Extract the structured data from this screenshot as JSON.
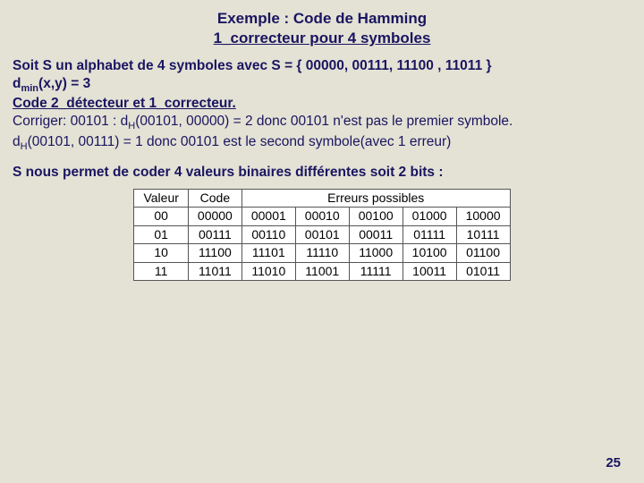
{
  "title": {
    "line1": "Exemple : Code de Hamming",
    "line2": "1_correcteur pour 4 symboles"
  },
  "body": {
    "p1a": "Soit S un alphabet de 4 symboles avec S = { 00000, 00111, 11100 , 11011 }",
    "p1b_pre": "d",
    "p1b_sub": "min",
    "p1b_post": "(x,y) = 3",
    "p1c": "Code 2_détecteur et 1_correcteur.",
    "p2a_pre": "Corriger:  00101 : d",
    "p2a_sub": "H",
    "p2a_post": "(00101, 00000) = 2 donc 00101 n'est pas le premier symbole.",
    "p2b_pre": "d",
    "p2b_sub": "H",
    "p2b_post": "(00101, 00111) = 1 donc 00101 est le second symbole(avec 1 erreur)",
    "p3": "S nous permet de coder 4 valeurs binaires différentes soit 2 bits :"
  },
  "table": {
    "headers": {
      "c1": "Valeur",
      "c2": "Code",
      "c3": "Erreurs possibles"
    },
    "rows": [
      {
        "val": "00",
        "code": "00000",
        "e": [
          "00001",
          "00010",
          "00100",
          "01000",
          "10000"
        ]
      },
      {
        "val": "01",
        "code": "00111",
        "e": [
          "00110",
          "00101",
          "00011",
          "01111",
          "10111"
        ]
      },
      {
        "val": "10",
        "code": "11100",
        "e": [
          "11101",
          "11110",
          "11000",
          "10100",
          "01100"
        ]
      },
      {
        "val": "11",
        "code": "11011",
        "e": [
          "11010",
          "11001",
          "11111",
          "10011",
          "01011"
        ]
      }
    ]
  },
  "page": "25"
}
